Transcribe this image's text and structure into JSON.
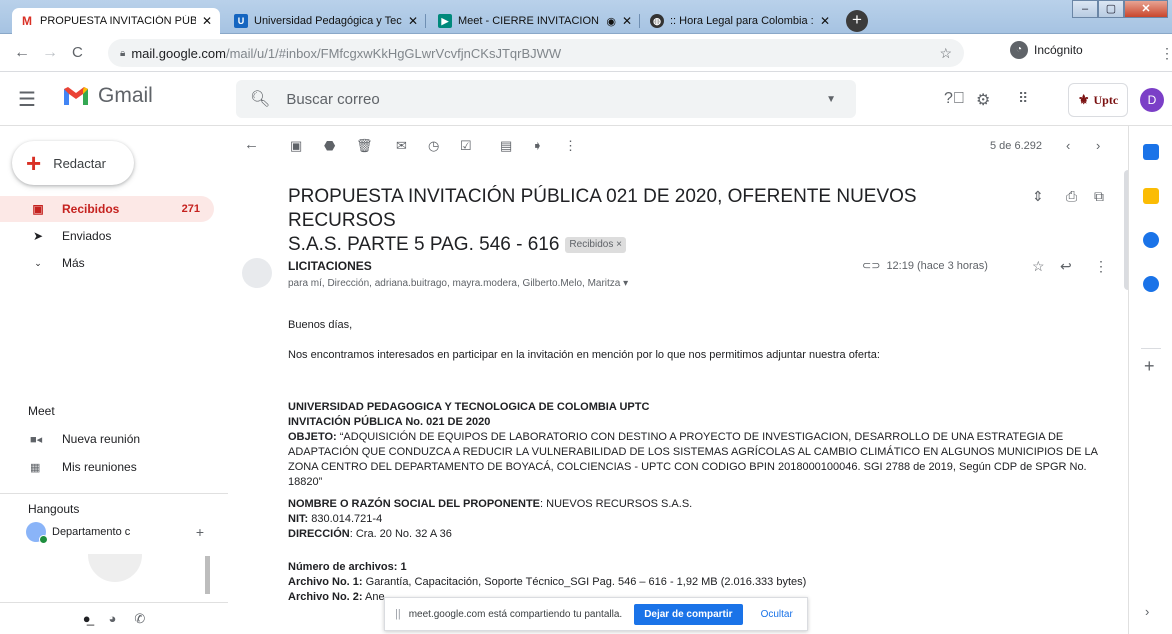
{
  "browser": {
    "tabs": [
      {
        "title": "PROPUESTA INVITACIÓN PÚBLIC",
        "favicon": "gmail-icon",
        "active": true
      },
      {
        "title": "Universidad Pedagógica y Tecnol",
        "favicon": "uptc-icon",
        "active": false
      },
      {
        "title": "Meet - CIERRE INVITACION",
        "favicon": "meet-icon",
        "active": false
      },
      {
        "title": ":: Hora Legal para Colombia ::",
        "favicon": "globe-icon",
        "active": false
      }
    ],
    "url_host": "mail.google.com",
    "url_path": "/mail/u/1/#inbox/FMfcgxwKkHgGLwrVcvfjnCKsJTqrBJWW",
    "incognito_label": "Incógnito"
  },
  "gmail": {
    "app_name": "Gmail",
    "search_placeholder": "Buscar correo",
    "account_badge": "Uptc",
    "avatar_letter": "D"
  },
  "sidebar": {
    "compose_label": "Redactar",
    "items": [
      {
        "label": "Recibidos",
        "count": "271",
        "icon": "inbox-icon"
      },
      {
        "label": "Enviados",
        "count": "",
        "icon": "send-icon"
      },
      {
        "label": "Más",
        "count": "",
        "icon": "chevron-down-icon"
      }
    ],
    "meet": {
      "title": "Meet",
      "new_meeting": "Nueva reunión",
      "my_meetings": "Mis reuniones"
    },
    "hangouts": {
      "title": "Hangouts",
      "user": "Departamento c"
    }
  },
  "toolbar": {
    "page_info": "5 de 6.292"
  },
  "email": {
    "subject_line1": "PROPUESTA INVITACIÓN PÚBLICA 021 DE 2020, OFERENTE NUEVOS RECURSOS",
    "subject_line2": "S.A.S. PARTE 5 PAG. 546 - 616",
    "label_chip": "Recibidos ×",
    "sender": "LICITACIONES",
    "recipients": "para mí, Dirección, adriana.buitrago, mayra.modera, Gilberto.Melo, Maritza ▾",
    "time": "12:19 (hace 3 horas)",
    "greeting": "Buenos días,",
    "intro": "Nos encontramos interesados en participar en la invitación en mención por lo que nos permitimos adjuntar nuestra oferta:",
    "university": "UNIVERSIDAD PEDAGOGICA Y TECNOLOGICA DE COLOMBIA UPTC",
    "invitation": "INVITACIÓN PÚBLICA No. 021 DE 2020",
    "objeto_label": "OBJETO:",
    "objeto_text": " “ADQUISICIÓN DE EQUIPOS DE LABORATORIO CON DESTINO A PROYECTO DE INVESTIGACION, DESARROLLO DE UNA ESTRATEGIA DE ADAPTACIÓN QUE CONDUZCA A REDUCIR LA VULNERABILIDAD DE LOS SISTEMAS AGRÍCOLAS AL CAMBIO CLIMÁTICO EN ALGUNOS MUNICIPIOS DE LA ZONA CENTRO DEL DEPARTAMENTO DE BOYACÁ, COLCIENCIAS - UPTC CON CODIGO BPIN 2018000100046. SGI 2788 de 2019, Según CDP de SPGR No. 18820”",
    "nombre_label": "NOMBRE O RAZÓN SOCIAL DEL PROPONENTE",
    "nombre_value": ": NUEVOS RECURSOS S.A.S.",
    "nit_label": "NIT:",
    "nit_value": " 830.014.721-4",
    "direccion_label": "DIRECCIÓN",
    "direccion_value": ": Cra. 20 No. 32 A 36",
    "num_archivos": "Número de archivos: 1",
    "archivo1_label": "Archivo No. 1:",
    "archivo1_value": " Garantía, Capacitación, Soporte Técnico_SGI Pag. 546 – 616 -  1,92 MB (2.016.333 bytes)",
    "archivo2_label": "Archivo No. 2:",
    "archivo2_value": " Ane"
  },
  "share_banner": {
    "message": "meet.google.com está compartiendo tu pantalla.",
    "stop_label": "Dejar de compartir",
    "hide_label": "Ocultar"
  }
}
